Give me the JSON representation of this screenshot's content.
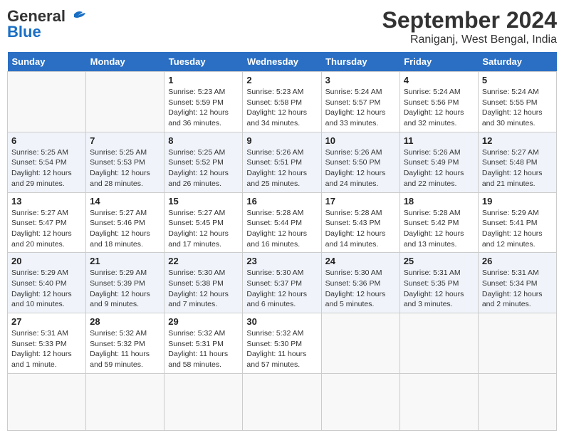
{
  "header": {
    "logo_line1": "General",
    "logo_line2": "Blue",
    "month": "September 2024",
    "location": "Raniganj, West Bengal, India"
  },
  "weekdays": [
    "Sunday",
    "Monday",
    "Tuesday",
    "Wednesday",
    "Thursday",
    "Friday",
    "Saturday"
  ],
  "days": [
    null,
    null,
    {
      "num": "1",
      "sunrise": "Sunrise: 5:23 AM",
      "sunset": "Sunset: 5:59 PM",
      "daylight": "Daylight: 12 hours and 36 minutes."
    },
    {
      "num": "2",
      "sunrise": "Sunrise: 5:23 AM",
      "sunset": "Sunset: 5:58 PM",
      "daylight": "Daylight: 12 hours and 34 minutes."
    },
    {
      "num": "3",
      "sunrise": "Sunrise: 5:24 AM",
      "sunset": "Sunset: 5:57 PM",
      "daylight": "Daylight: 12 hours and 33 minutes."
    },
    {
      "num": "4",
      "sunrise": "Sunrise: 5:24 AM",
      "sunset": "Sunset: 5:56 PM",
      "daylight": "Daylight: 12 hours and 32 minutes."
    },
    {
      "num": "5",
      "sunrise": "Sunrise: 5:24 AM",
      "sunset": "Sunset: 5:55 PM",
      "daylight": "Daylight: 12 hours and 30 minutes."
    },
    {
      "num": "6",
      "sunrise": "Sunrise: 5:25 AM",
      "sunset": "Sunset: 5:54 PM",
      "daylight": "Daylight: 12 hours and 29 minutes."
    },
    {
      "num": "7",
      "sunrise": "Sunrise: 5:25 AM",
      "sunset": "Sunset: 5:53 PM",
      "daylight": "Daylight: 12 hours and 28 minutes."
    },
    {
      "num": "8",
      "sunrise": "Sunrise: 5:25 AM",
      "sunset": "Sunset: 5:52 PM",
      "daylight": "Daylight: 12 hours and 26 minutes."
    },
    {
      "num": "9",
      "sunrise": "Sunrise: 5:26 AM",
      "sunset": "Sunset: 5:51 PM",
      "daylight": "Daylight: 12 hours and 25 minutes."
    },
    {
      "num": "10",
      "sunrise": "Sunrise: 5:26 AM",
      "sunset": "Sunset: 5:50 PM",
      "daylight": "Daylight: 12 hours and 24 minutes."
    },
    {
      "num": "11",
      "sunrise": "Sunrise: 5:26 AM",
      "sunset": "Sunset: 5:49 PM",
      "daylight": "Daylight: 12 hours and 22 minutes."
    },
    {
      "num": "12",
      "sunrise": "Sunrise: 5:27 AM",
      "sunset": "Sunset: 5:48 PM",
      "daylight": "Daylight: 12 hours and 21 minutes."
    },
    {
      "num": "13",
      "sunrise": "Sunrise: 5:27 AM",
      "sunset": "Sunset: 5:47 PM",
      "daylight": "Daylight: 12 hours and 20 minutes."
    },
    {
      "num": "14",
      "sunrise": "Sunrise: 5:27 AM",
      "sunset": "Sunset: 5:46 PM",
      "daylight": "Daylight: 12 hours and 18 minutes."
    },
    {
      "num": "15",
      "sunrise": "Sunrise: 5:27 AM",
      "sunset": "Sunset: 5:45 PM",
      "daylight": "Daylight: 12 hours and 17 minutes."
    },
    {
      "num": "16",
      "sunrise": "Sunrise: 5:28 AM",
      "sunset": "Sunset: 5:44 PM",
      "daylight": "Daylight: 12 hours and 16 minutes."
    },
    {
      "num": "17",
      "sunrise": "Sunrise: 5:28 AM",
      "sunset": "Sunset: 5:43 PM",
      "daylight": "Daylight: 12 hours and 14 minutes."
    },
    {
      "num": "18",
      "sunrise": "Sunrise: 5:28 AM",
      "sunset": "Sunset: 5:42 PM",
      "daylight": "Daylight: 12 hours and 13 minutes."
    },
    {
      "num": "19",
      "sunrise": "Sunrise: 5:29 AM",
      "sunset": "Sunset: 5:41 PM",
      "daylight": "Daylight: 12 hours and 12 minutes."
    },
    {
      "num": "20",
      "sunrise": "Sunrise: 5:29 AM",
      "sunset": "Sunset: 5:40 PM",
      "daylight": "Daylight: 12 hours and 10 minutes."
    },
    {
      "num": "21",
      "sunrise": "Sunrise: 5:29 AM",
      "sunset": "Sunset: 5:39 PM",
      "daylight": "Daylight: 12 hours and 9 minutes."
    },
    {
      "num": "22",
      "sunrise": "Sunrise: 5:30 AM",
      "sunset": "Sunset: 5:38 PM",
      "daylight": "Daylight: 12 hours and 7 minutes."
    },
    {
      "num": "23",
      "sunrise": "Sunrise: 5:30 AM",
      "sunset": "Sunset: 5:37 PM",
      "daylight": "Daylight: 12 hours and 6 minutes."
    },
    {
      "num": "24",
      "sunrise": "Sunrise: 5:30 AM",
      "sunset": "Sunset: 5:36 PM",
      "daylight": "Daylight: 12 hours and 5 minutes."
    },
    {
      "num": "25",
      "sunrise": "Sunrise: 5:31 AM",
      "sunset": "Sunset: 5:35 PM",
      "daylight": "Daylight: 12 hours and 3 minutes."
    },
    {
      "num": "26",
      "sunrise": "Sunrise: 5:31 AM",
      "sunset": "Sunset: 5:34 PM",
      "daylight": "Daylight: 12 hours and 2 minutes."
    },
    {
      "num": "27",
      "sunrise": "Sunrise: 5:31 AM",
      "sunset": "Sunset: 5:33 PM",
      "daylight": "Daylight: 12 hours and 1 minute."
    },
    {
      "num": "28",
      "sunrise": "Sunrise: 5:32 AM",
      "sunset": "Sunset: 5:32 PM",
      "daylight": "Daylight: 11 hours and 59 minutes."
    },
    {
      "num": "29",
      "sunrise": "Sunrise: 5:32 AM",
      "sunset": "Sunset: 5:31 PM",
      "daylight": "Daylight: 11 hours and 58 minutes."
    },
    {
      "num": "30",
      "sunrise": "Sunrise: 5:32 AM",
      "sunset": "Sunset: 5:30 PM",
      "daylight": "Daylight: 11 hours and 57 minutes."
    },
    null,
    null,
    null,
    null,
    null
  ]
}
